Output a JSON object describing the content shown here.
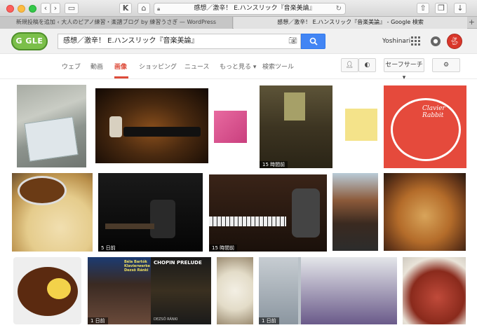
{
  "browser": {
    "address": "感想／激辛！ E.ハンスリック『音楽美論』",
    "tabs": [
      {
        "label": "新規投稿を追加 ‹ 大人のピアノ練習・楽譜ブログ by 練習うさぎ — WordPress"
      },
      {
        "label": "感想／激辛！ E.ハンスリック『音楽美論』 - Google 検索"
      }
    ],
    "new_tab_icon": "plus-icon"
  },
  "header": {
    "logo_text": "G   GLE",
    "query": "感想／激辛！ E.ハンスリック『音楽美論』",
    "user_name": "Yoshinari",
    "search_icon": "magnifier-icon"
  },
  "nav": {
    "items": [
      "ウェブ",
      "動画",
      "画像",
      "ショッピング",
      "ニュース",
      "もっと見る ▾",
      "検索ツール"
    ],
    "active": "画像",
    "safe_search": "セーフサーチ ▾"
  },
  "images": [
    {
      "id": "books",
      "timestamp": ""
    },
    {
      "id": "pianist-stage",
      "timestamp": ""
    },
    {
      "id": "pink-book",
      "timestamp": ""
    },
    {
      "id": "stone-corridor",
      "timestamp": "15 時間前"
    },
    {
      "id": "yellow-book",
      "timestamp": ""
    },
    {
      "id": "clavier-rabbit",
      "timestamp": "",
      "text": "Clavier Rabbit"
    },
    {
      "id": "udon",
      "timestamp": ""
    },
    {
      "id": "pianist-dark",
      "timestamp": "5 日前"
    },
    {
      "id": "pianist-grand",
      "timestamp": "15 時間前"
    },
    {
      "id": "shrine",
      "timestamp": ""
    },
    {
      "id": "okonomiyaki",
      "timestamp": ""
    },
    {
      "id": "curry",
      "timestamp": ""
    },
    {
      "id": "cd-covers",
      "timestamp": "1 日前",
      "text1": "Béla Bartók Klavierwerke Dezsö Ránki",
      "text2": "CHOPIN PRELUDE",
      "text3": "DEZSŐ RÁNKI"
    },
    {
      "id": "soup",
      "timestamp": ""
    },
    {
      "id": "portraits",
      "timestamp": "1 日前"
    },
    {
      "id": "roast-beef",
      "timestamp": ""
    }
  ]
}
